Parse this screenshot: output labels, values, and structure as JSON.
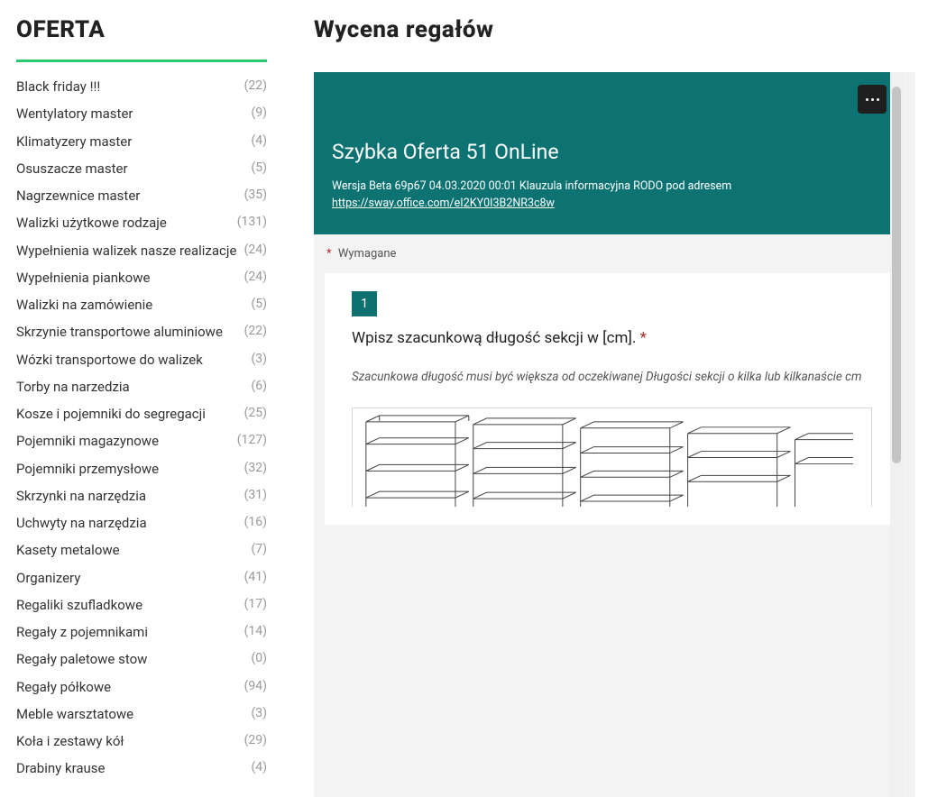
{
  "sidebar": {
    "title": "OFERTA",
    "items": [
      {
        "label": "Black friday !!!",
        "count": "(22)"
      },
      {
        "label": "Wentylatory master",
        "count": "(9)"
      },
      {
        "label": "Klimatyzery master",
        "count": "(4)"
      },
      {
        "label": "Osuszacze master",
        "count": "(5)"
      },
      {
        "label": "Nagrzewnice master",
        "count": "(35)"
      },
      {
        "label": "Walizki użytkowe rodzaje",
        "count": "(131)"
      },
      {
        "label": "Wypełnienia walizek nasze realizacje",
        "count": "(24)"
      },
      {
        "label": "Wypełnienia piankowe",
        "count": "(24)"
      },
      {
        "label": "Walizki na zamówienie",
        "count": "(5)"
      },
      {
        "label": "Skrzynie transportowe aluminiowe",
        "count": "(22)"
      },
      {
        "label": "Wózki transportowe do walizek",
        "count": "(3)"
      },
      {
        "label": "Torby na narzedzia",
        "count": "(6)"
      },
      {
        "label": "Kosze i pojemniki do segregacji",
        "count": "(25)"
      },
      {
        "label": "Pojemniki magazynowe",
        "count": "(127)"
      },
      {
        "label": "Pojemniki przemysłowe",
        "count": "(32)"
      },
      {
        "label": "Skrzynki na narzędzia",
        "count": "(31)"
      },
      {
        "label": "Uchwyty na narzędzia",
        "count": "(16)"
      },
      {
        "label": "Kasety metalowe",
        "count": "(7)"
      },
      {
        "label": "Organizery",
        "count": "(41)"
      },
      {
        "label": "Regaliki szufladkowe",
        "count": "(17)"
      },
      {
        "label": "Regały z pojemnikami",
        "count": "(14)"
      },
      {
        "label": "Regały paletowe stow",
        "count": "(0)"
      },
      {
        "label": "Regały półkowe",
        "count": "(94)"
      },
      {
        "label": "Meble warsztatowe",
        "count": "(3)"
      },
      {
        "label": "Koła i zestawy kół",
        "count": "(29)"
      },
      {
        "label": "Drabiny krause",
        "count": "(4)"
      }
    ]
  },
  "main": {
    "title": "Wycena regałów"
  },
  "form": {
    "title": "Szybka Oferta 51 OnLine",
    "subtitle_prefix": "Wersja Beta 69p67 04.03.2020 00:01 Klauzula informacyjna RODO pod adresem ",
    "subtitle_link": "https://sway.office.com/eI2KY0I3B2NR3c8w",
    "required_label": "Wymagane",
    "q1": {
      "num": "1",
      "title": "Wpisz szacunkową długość sekcji w [cm]. ",
      "asterisk": "*",
      "hint": "Szacunkowa długość musi być większa od oczekiwanej Długości sekcji o kilka lub kilkanaście cm"
    }
  }
}
